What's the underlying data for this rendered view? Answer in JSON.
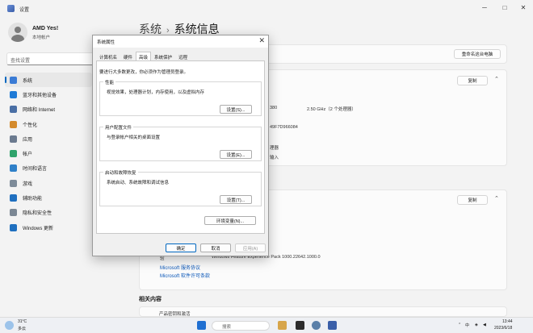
{
  "window": {
    "title": "设置",
    "controls": [
      "─",
      "□",
      "✕"
    ]
  },
  "profile": {
    "name": "AMD Yes!",
    "subtitle": "本地帐户"
  },
  "search": {
    "placeholder": "查找设置"
  },
  "nav": [
    {
      "label": "系统",
      "icon": "system-icon",
      "color": "#3a7bd5",
      "active": true
    },
    {
      "label": "蓝牙和其他设备",
      "icon": "bluetooth-icon",
      "color": "#1e7ad6"
    },
    {
      "label": "网络和 Internet",
      "icon": "network-icon",
      "color": "#4a6fa5"
    },
    {
      "label": "个性化",
      "icon": "brush-icon",
      "color": "#d48a2c"
    },
    {
      "label": "应用",
      "icon": "apps-icon",
      "color": "#6b7a8f"
    },
    {
      "label": "帐户",
      "icon": "account-icon",
      "color": "#2fa36b"
    },
    {
      "label": "时间和语言",
      "icon": "globe-icon",
      "color": "#2f80c8"
    },
    {
      "label": "游戏",
      "icon": "game-icon",
      "color": "#7d8b99"
    },
    {
      "label": "辅助功能",
      "icon": "accessibility-icon",
      "color": "#1f6fbf"
    },
    {
      "label": "隐私和安全性",
      "icon": "shield-icon",
      "color": "#7b8794"
    },
    {
      "label": "Windows 更新",
      "icon": "update-icon",
      "color": "#1f6fbf"
    }
  ],
  "header": {
    "breadcrumb": "系统",
    "separator": "›",
    "title": "系统信息"
  },
  "background": {
    "rename_button": "重命名这台电脑",
    "copy_button_1": "复制",
    "copy_button_2": "复制",
    "fragments": [
      "380",
      "2.50 GHz（2 个处理器）",
      "49F7D966084",
      "理器",
      "输入"
    ],
    "exp_label": "验",
    "exp_value": "Windows Feature Experience Pack 1000.22642.1000.0",
    "link_1": "Microsoft 服务协议",
    "link_2": "Microsoft 软件许可条款",
    "related_heading": "相关内容",
    "related_item": "产品密钥和激活"
  },
  "dialog": {
    "title": "系统属性",
    "close": "✕",
    "tabs": [
      "计算机名",
      "硬件",
      "高级",
      "系统保护",
      "远程"
    ],
    "active_tab": 2,
    "note": "要进行大多数更改，你必须作为管理员登录。",
    "groups": [
      {
        "title": "性能",
        "desc": "视觉效果，处理器计划，内存使用，以及虚拟内存",
        "button": "设置(S)..."
      },
      {
        "title": "用户配置文件",
        "desc": "与登录帐户相关的桌面设置",
        "button": "设置(E)..."
      },
      {
        "title": "启动和故障恢复",
        "desc": "系统启动、系统故障和调试信息",
        "button": "设置(T)..."
      }
    ],
    "env_button": "环境变量(N)...",
    "ok": "确定",
    "cancel": "取消",
    "apply": "应用(A)"
  },
  "taskbar": {
    "weather_temp": "31°C",
    "weather_desc": "多云",
    "search_placeholder": "搜索",
    "time": "13:44",
    "date": "2023/6/18",
    "tray_lang": "中",
    "apps": [
      "start-icon",
      "taskview-icon",
      "explorer-icon",
      "edge-icon",
      "store-icon",
      "settings-icon",
      "control-panel-icon"
    ]
  }
}
